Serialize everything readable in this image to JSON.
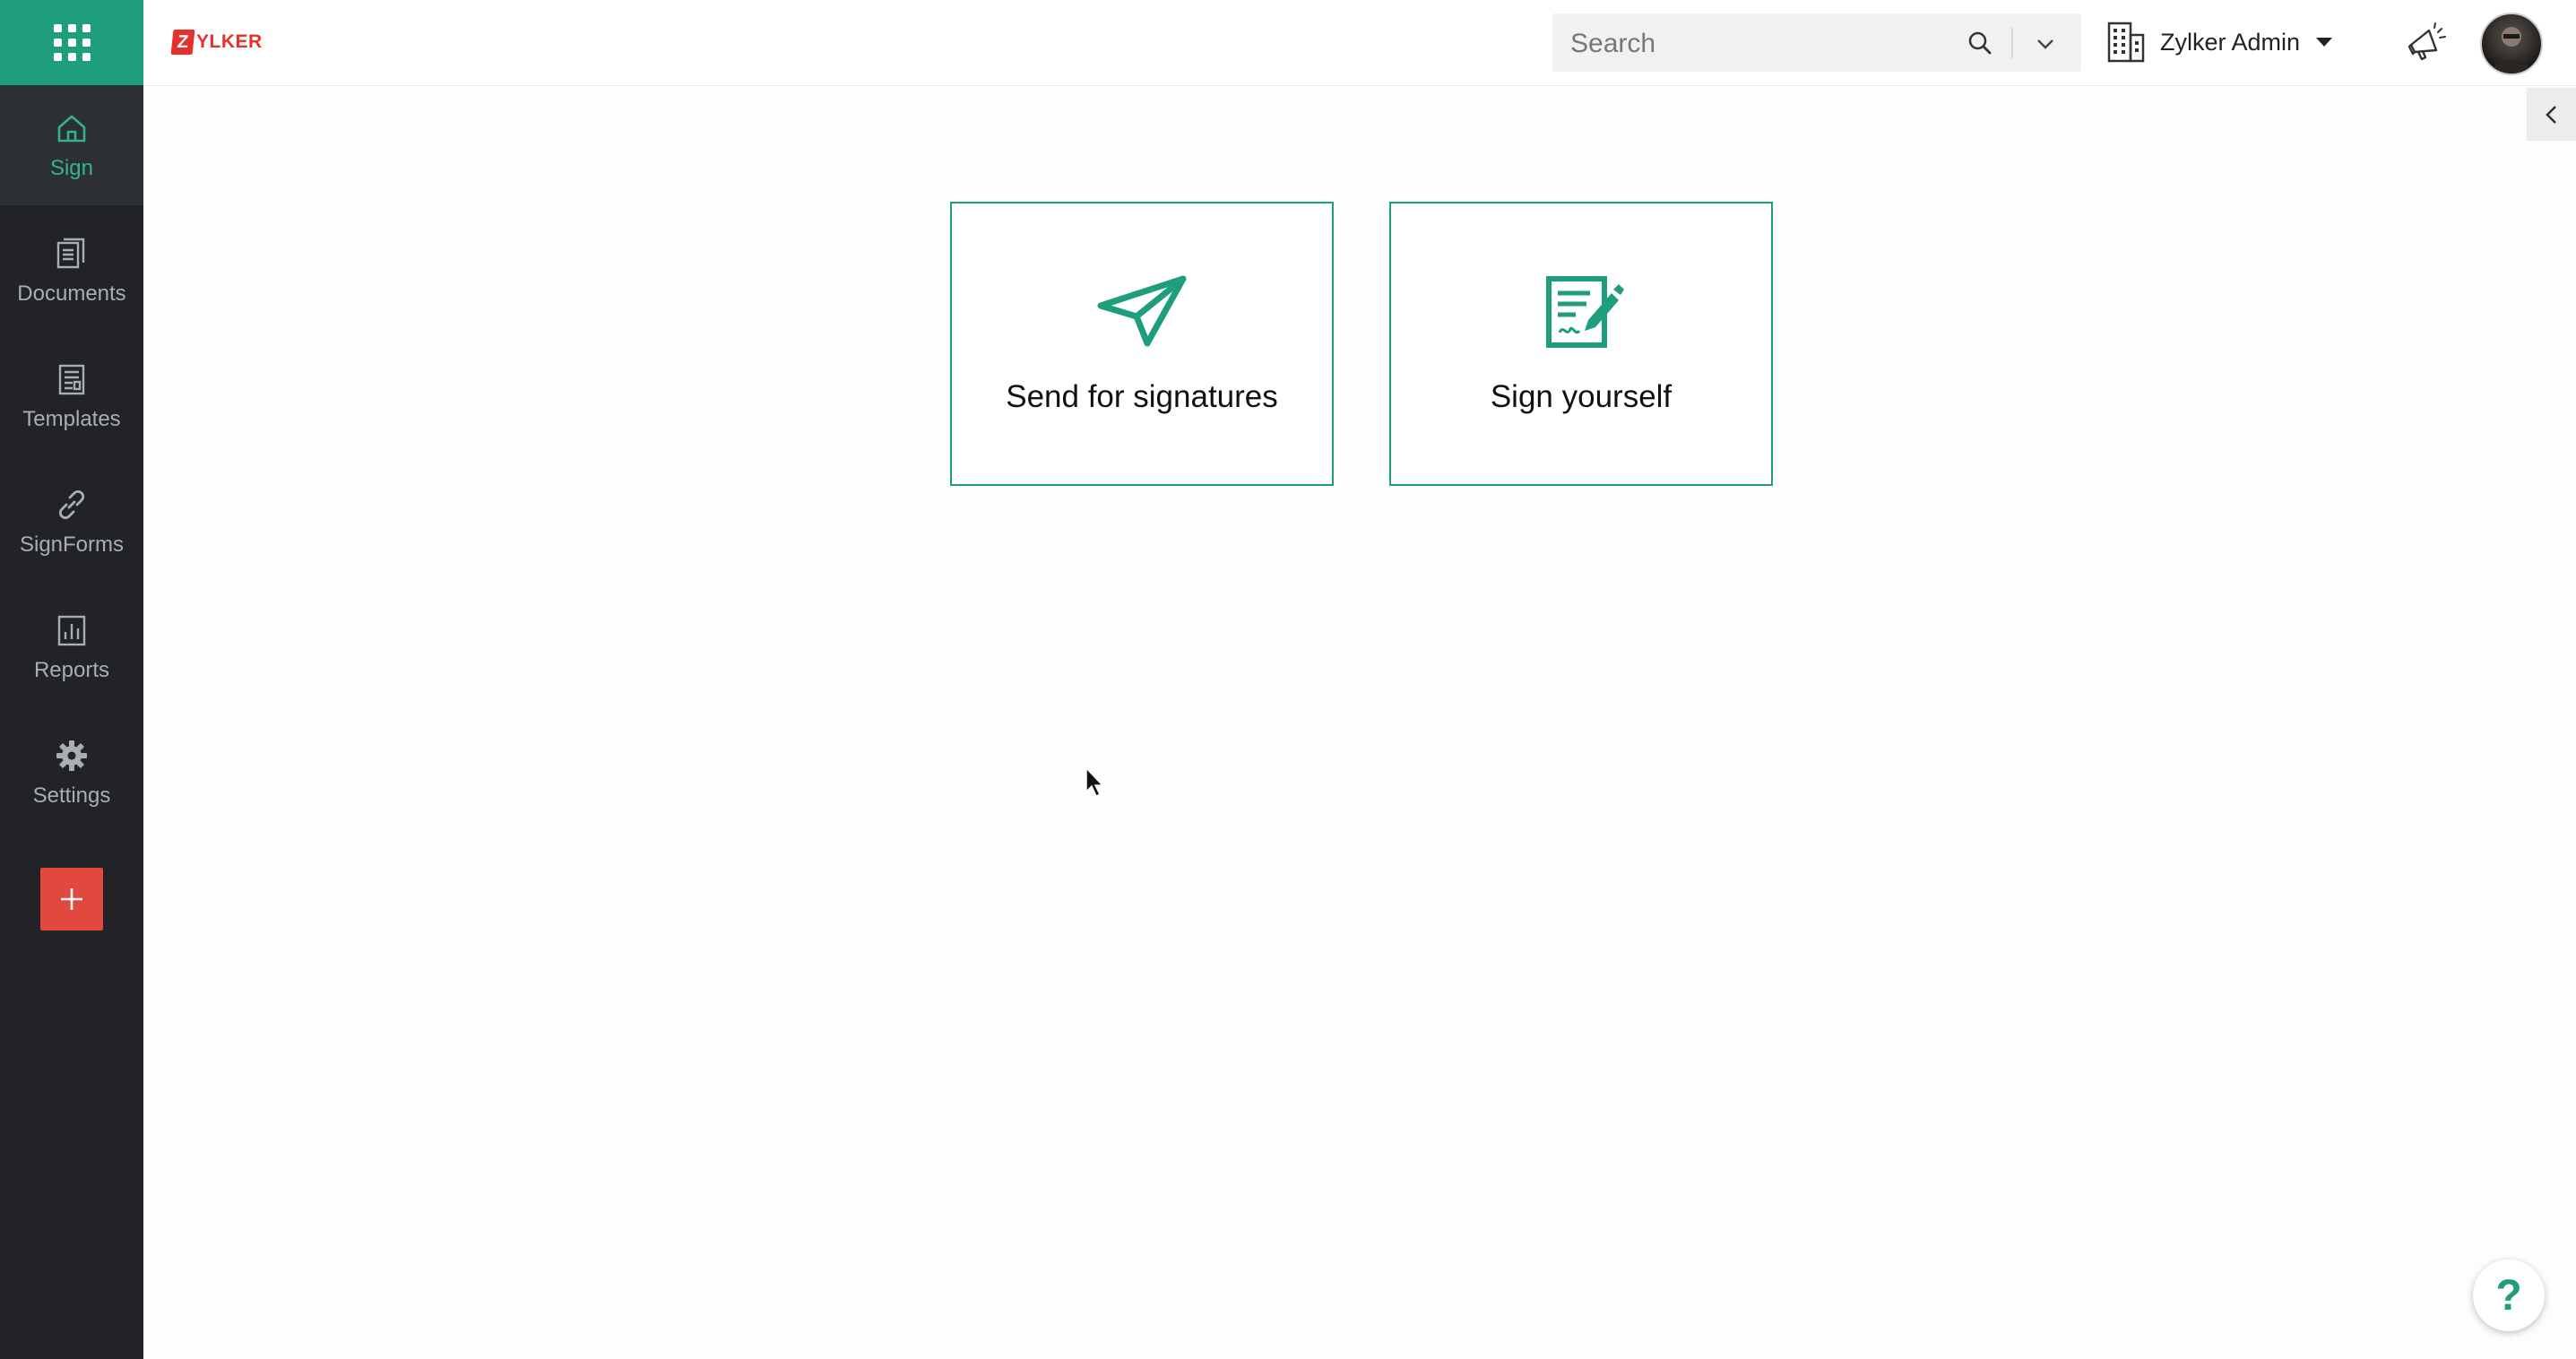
{
  "brand": {
    "logo_initial": "Z",
    "logo_rest": "YLKER",
    "accent": "#1f9e7e",
    "logo_color": "#e4322b",
    "create_color": "#e2483d"
  },
  "sidebar": {
    "apps_icon": "apps-grid-icon",
    "items": [
      {
        "label": "Sign",
        "icon": "home-icon",
        "active": true
      },
      {
        "label": "Documents",
        "icon": "documents-icon",
        "active": false
      },
      {
        "label": "Templates",
        "icon": "templates-icon",
        "active": false
      },
      {
        "label": "SignForms",
        "icon": "link-icon",
        "active": false
      },
      {
        "label": "Reports",
        "icon": "reports-icon",
        "active": false
      },
      {
        "label": "Settings",
        "icon": "gear-icon",
        "active": false
      }
    ],
    "create_icon": "plus-icon"
  },
  "header": {
    "search": {
      "placeholder": "Search",
      "value": ""
    },
    "org": {
      "name": "Zylker Admin",
      "icon": "building-icon"
    },
    "announcements_icon": "megaphone-icon",
    "avatar_icon": "user-avatar"
  },
  "main": {
    "cards": [
      {
        "label": "Send for signatures",
        "icon": "paper-plane-icon"
      },
      {
        "label": "Sign yourself",
        "icon": "sign-document-icon"
      }
    ]
  },
  "help": {
    "label": "?"
  }
}
